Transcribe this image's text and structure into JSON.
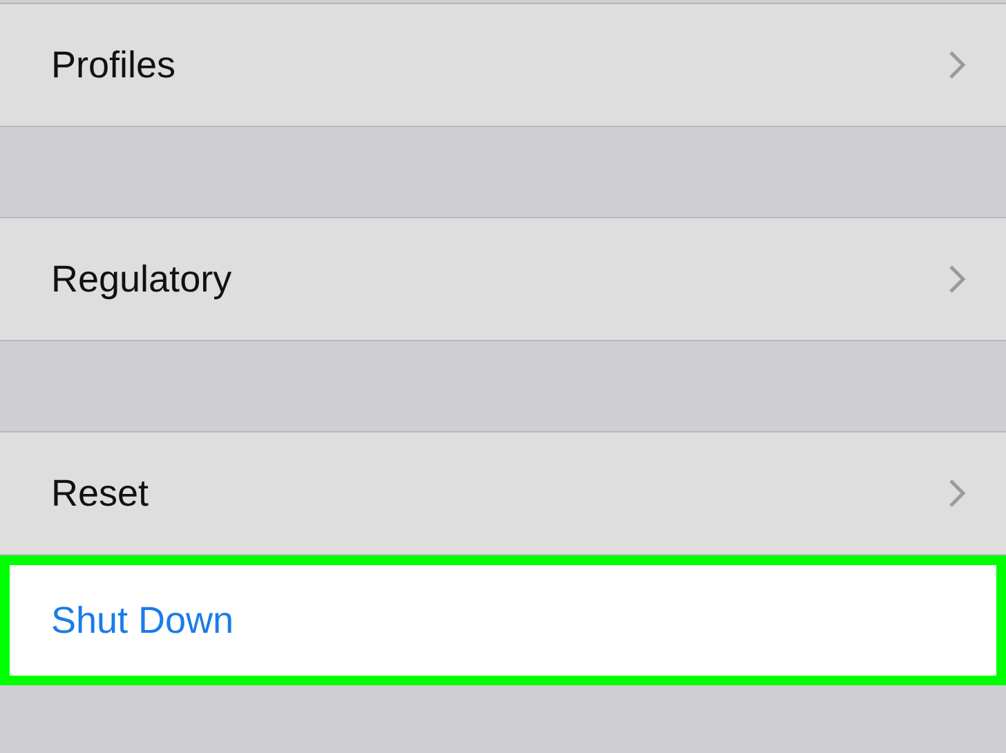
{
  "rows": [
    {
      "label": "Profiles",
      "kind": "nav",
      "highlighted": false
    },
    {
      "label": "Regulatory",
      "kind": "nav",
      "highlighted": false
    },
    {
      "label": "Reset",
      "kind": "nav",
      "highlighted": false
    },
    {
      "label": "Shut Down",
      "kind": "action",
      "highlighted": true
    }
  ]
}
